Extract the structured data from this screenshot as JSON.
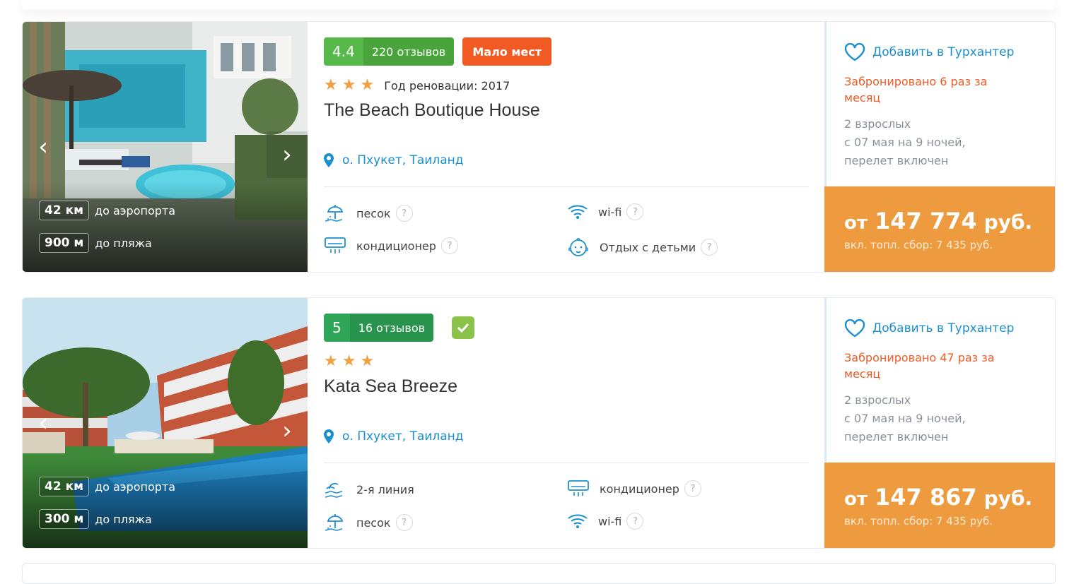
{
  "hotels": [
    {
      "score": "4.4",
      "reviews": "220 отзывов",
      "badge": "Мало мест",
      "renovation": "Год реновации: 2017",
      "name": "The Beach Boutique House",
      "location": "о. Пхукет, Таиланд",
      "distance_airport": "42 км",
      "distance_airport_label": "до аэропорта",
      "distance_beach": "900 м",
      "distance_beach_label": "до пляжа",
      "amenities": [
        {
          "icon": "beach-umbrella-icon",
          "label": "песок",
          "help": "?"
        },
        {
          "icon": "wifi-icon",
          "label": "wi-fi",
          "help": "?"
        },
        {
          "icon": "air-conditioner-icon",
          "label": "кондиционер",
          "help": "?"
        },
        {
          "icon": "baby-icon",
          "label": "Отдых с детьми",
          "help": "?"
        }
      ],
      "favorite": "Добавить в Турхантер",
      "booked": "Забронировано 6 раз за месяц",
      "guests": "2 взрослых",
      "dates": "с 07 мая на 9 ночей,",
      "flight": "перелет включен",
      "price_from": "от",
      "price": "147 774",
      "currency": "руб.",
      "fee": "вкл. топл. сбор: 7 435 руб."
    },
    {
      "score": "5",
      "reviews": "16 отзывов",
      "badge": "",
      "renovation": "",
      "name": "Kata Sea Breeze",
      "location": "о. Пхукет, Таиланд",
      "distance_airport": "42 км",
      "distance_airport_label": "до аэропорта",
      "distance_beach": "300 м",
      "distance_beach_label": "до пляжа",
      "amenities": [
        {
          "icon": "beach-line-icon",
          "label": "2-я линия",
          "help": ""
        },
        {
          "icon": "air-conditioner-icon",
          "label": "кондиционер",
          "help": "?"
        },
        {
          "icon": "beach-umbrella-icon",
          "label": "песок",
          "help": "?"
        },
        {
          "icon": "wifi-icon",
          "label": "wi-fi",
          "help": "?"
        }
      ],
      "favorite": "Добавить в Турхантер",
      "booked": "Забронировано 47 раз за месяц",
      "guests": "2 взрослых",
      "dates": "с 07 мая на 9 ночей,",
      "flight": "перелет включен",
      "price_from": "от",
      "price": "147 867",
      "currency": "руб.",
      "fee": "вкл. топл. сбор: 7 435 руб."
    }
  ],
  "colors": {
    "accent_blue": "#1a8fcf",
    "orange_price": "#ee9a3e",
    "red_badge": "#f25a23",
    "green_rating": "#57b94a"
  }
}
